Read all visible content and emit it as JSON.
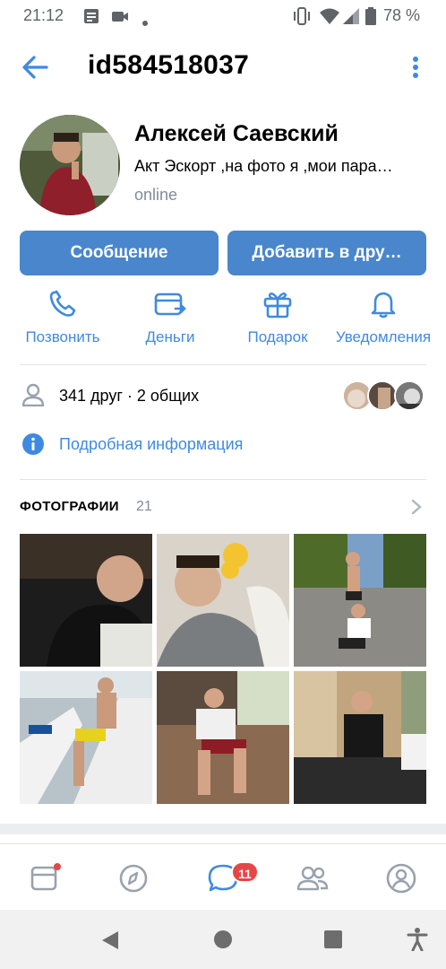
{
  "status_bar": {
    "time": "21:12",
    "battery": "78 %",
    "icons": [
      "notes-icon",
      "video-icon",
      "dot-icon",
      "vibrate-icon",
      "wifi-icon",
      "signal-icon",
      "battery-icon"
    ]
  },
  "header": {
    "title": "id584518037",
    "back_icon": "arrow-left-icon",
    "more_icon": "more-vertical-icon"
  },
  "profile": {
    "name": "Алексей Саевский",
    "status": "Акт Эскорт ,на фото я ,мои пара…",
    "online": "online",
    "message_button": "Сообщение",
    "add_friend_button": "Добавить в дру…"
  },
  "actions": [
    {
      "label": "Позвонить",
      "icon": "phone-icon"
    },
    {
      "label": "Деньги",
      "icon": "money-icon"
    },
    {
      "label": "Подарок",
      "icon": "gift-icon"
    },
    {
      "label": "Уведомления",
      "icon": "bell-icon"
    }
  ],
  "friends": {
    "text": "341 друг · 2 общих",
    "icon": "user-icon"
  },
  "details": {
    "text": "Подробная информация",
    "icon": "info-icon"
  },
  "photos": {
    "title": "ФОТОГРАФИИ",
    "count": "21"
  },
  "tab_bar": {
    "items": [
      "feed-icon",
      "explore-icon",
      "messages-icon",
      "friends-icon",
      "profile-icon"
    ],
    "messages_badge": "11"
  },
  "nav_bar": {
    "items": [
      "back-triangle-icon",
      "home-circle-icon",
      "recents-square-icon",
      "accessibility-icon"
    ]
  },
  "colors": {
    "accent": "#4986cc",
    "link": "#3f8ae0",
    "secondary_text": "#818c99",
    "badge": "#e64646"
  }
}
